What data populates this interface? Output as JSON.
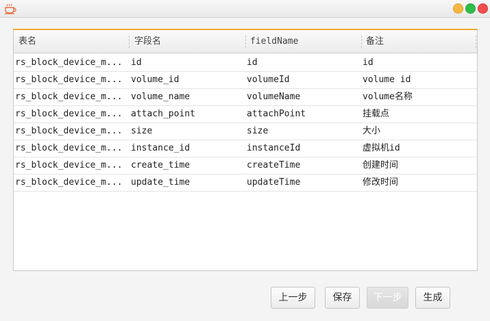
{
  "window": {
    "icon": "coffee-cup-icon",
    "controls": [
      "minimize",
      "maximize",
      "close"
    ],
    "accent_color": "#f0a830"
  },
  "table": {
    "columns": [
      "表名",
      "字段名",
      "fieldName",
      "备注"
    ],
    "rows": [
      [
        "rs_block_device_m...",
        "id",
        "id",
        "id"
      ],
      [
        "rs_block_device_m...",
        "volume_id",
        "volumeId",
        "volume id"
      ],
      [
        "rs_block_device_m...",
        "volume_name",
        "volumeName",
        "volume名称"
      ],
      [
        "rs_block_device_m...",
        "attach_point",
        "attachPoint",
        "挂载点"
      ],
      [
        "rs_block_device_m...",
        "size",
        "size",
        "大小"
      ],
      [
        "rs_block_device_m...",
        "instance_id",
        "instanceId",
        "虚拟机id"
      ],
      [
        "rs_block_device_m...",
        "create_time",
        "createTime",
        "创建时间"
      ],
      [
        "rs_block_device_m...",
        "update_time",
        "updateTime",
        "修改时间"
      ]
    ]
  },
  "buttons": {
    "prev": "上一步",
    "save": "保存",
    "next": "下一步",
    "generate": "生成"
  }
}
